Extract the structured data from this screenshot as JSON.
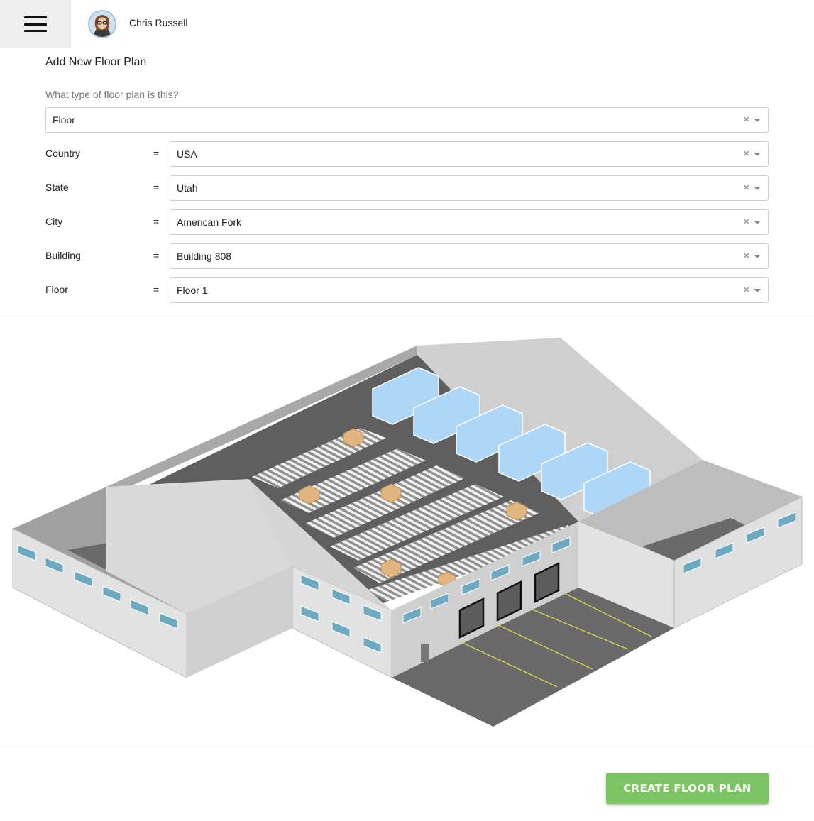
{
  "header": {
    "menu_icon": "hamburger-menu-icon",
    "user_name": "Chris Russell"
  },
  "form": {
    "title": "Add New Floor Plan",
    "question": "What type of floor plan is this?",
    "plan_type": {
      "value": "Floor"
    },
    "fields": [
      {
        "label": "Country",
        "operator": "=",
        "value": "USA"
      },
      {
        "label": "State",
        "operator": "=",
        "value": "Utah"
      },
      {
        "label": "City",
        "operator": "=",
        "value": "American Fork"
      },
      {
        "label": "Building",
        "operator": "=",
        "value": "Building 808"
      },
      {
        "label": "Floor",
        "operator": "=",
        "value": "Floor 1"
      }
    ],
    "clear_icon": "×"
  },
  "footer": {
    "create_label": "CREATE FLOOR PLAN"
  },
  "colors": {
    "accent": "#7cc464",
    "cold_storage": "#aed6f6",
    "floor": "#6e6e6e",
    "wall": "#d9d9d9"
  }
}
